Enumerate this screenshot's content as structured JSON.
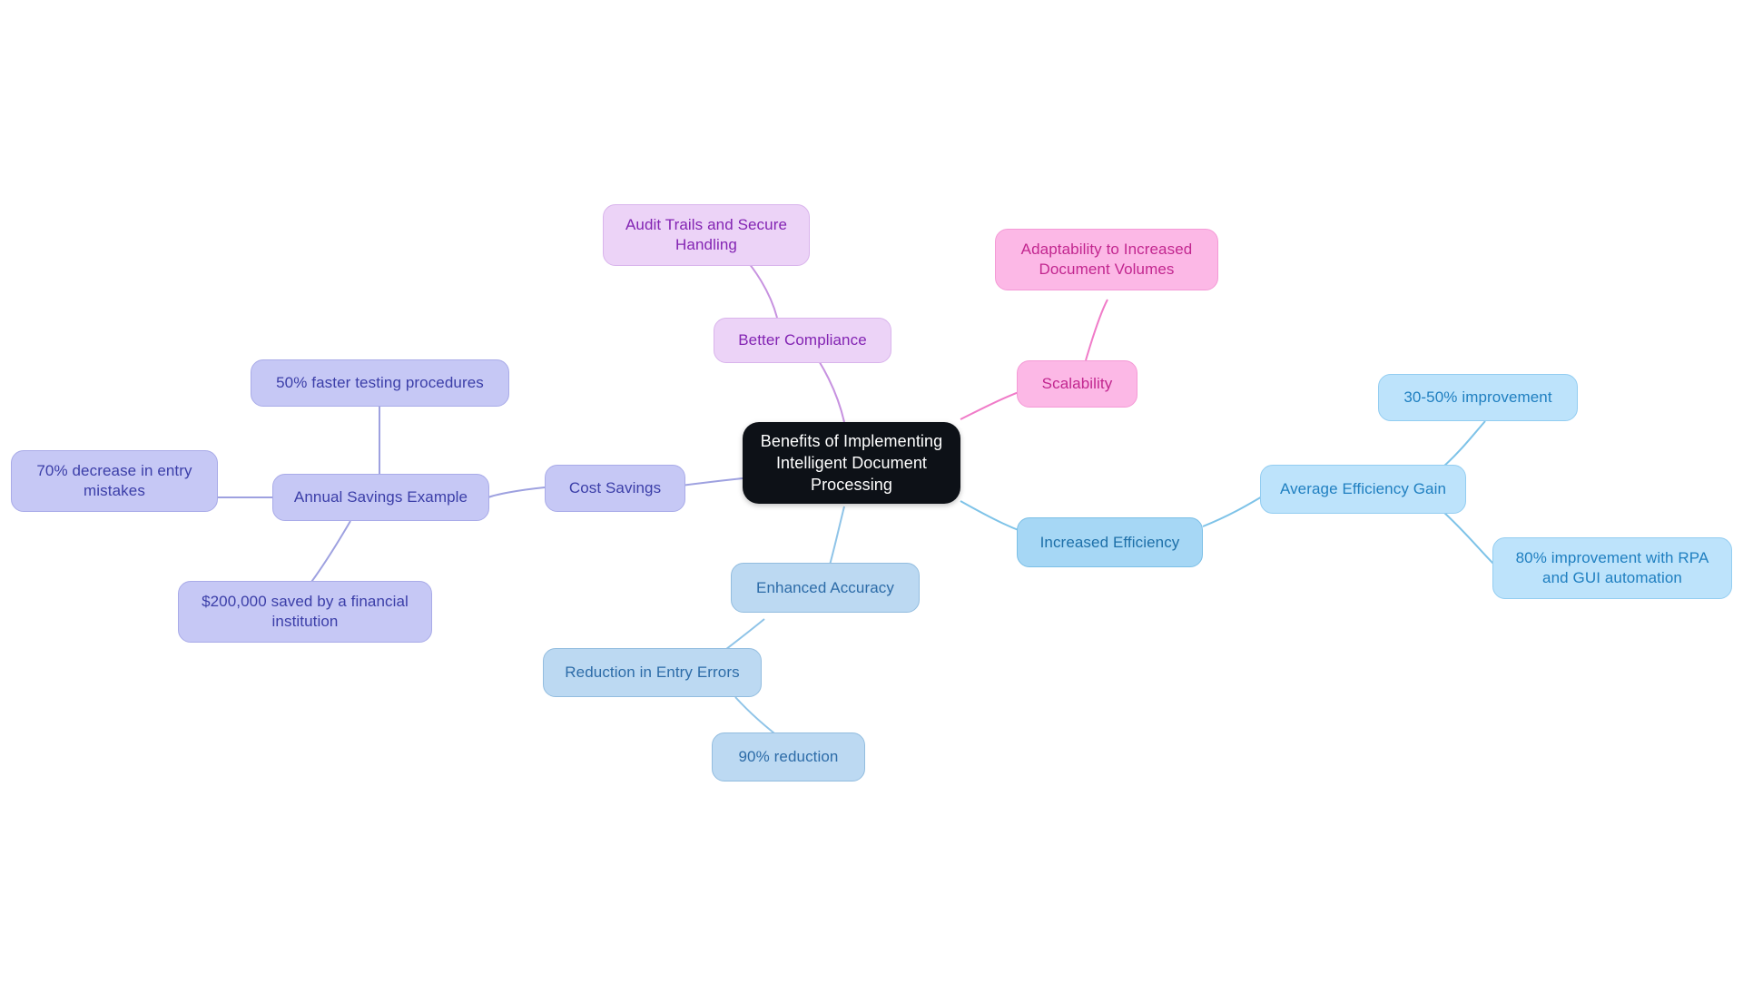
{
  "diagram": {
    "type": "mindmap",
    "title": "Benefits of Implementing Intelligent Document Processing",
    "background_color": "#ffffff",
    "root": {
      "id": "root",
      "label": "Benefits of Implementing\nIntelligent Document\nProcessing",
      "fill": "#0d1117",
      "text_color": "#ffffff"
    },
    "branches": [
      {
        "id": "better-compliance",
        "label": "Better Compliance",
        "fill": "#ecd3f7",
        "text_color": "#8324b3",
        "edge_color": "#c792e0",
        "children": [
          {
            "id": "audit-trails-and-secure-handling",
            "label": "Audit Trails and Secure\nHandling",
            "fill": "#ecd3f7",
            "text_color": "#8324b3",
            "edge_color": "#c792e0"
          }
        ]
      },
      {
        "id": "scalability",
        "label": "Scalability",
        "fill": "#fcb8e6",
        "text_color": "#c2268f",
        "edge_color": "#f07bc8",
        "children": [
          {
            "id": "adaptability-to-increased-document-volumes",
            "label": "Adaptability to Increased\nDocument Volumes",
            "fill": "#fcb8e6",
            "text_color": "#c2268f",
            "edge_color": "#f07bc8"
          }
        ]
      },
      {
        "id": "increased-efficiency",
        "label": "Increased Efficiency",
        "fill": "#a6d7f5",
        "text_color": "#1d6fa8",
        "edge_color": "#7ec3e8",
        "children": [
          {
            "id": "average-efficiency-gain",
            "label": "Average Efficiency Gain",
            "fill": "#bde3fb",
            "text_color": "#1f7fc0",
            "edge_color": "#7ec3e8",
            "children": [
              {
                "id": "30-50-improvement",
                "label": "30-50% improvement",
                "fill": "#bde3fb",
                "text_color": "#1f7fc0",
                "edge_color": "#7ec3e8"
              },
              {
                "id": "80-improvement-with-rpa-and-gui-automation",
                "label": "80% improvement with RPA\nand GUI automation",
                "fill": "#bde3fb",
                "text_color": "#1f7fc0",
                "edge_color": "#7ec3e8"
              }
            ]
          }
        ]
      },
      {
        "id": "enhanced-accuracy",
        "label": "Enhanced Accuracy",
        "fill": "#bcd9f2",
        "text_color": "#2d6ca8",
        "edge_color": "#8fc4e8",
        "children": [
          {
            "id": "reduction-in-entry-errors",
            "label": "Reduction in Entry Errors",
            "fill": "#bcd9f2",
            "text_color": "#2d6ca8",
            "edge_color": "#8fc4e8",
            "children": [
              {
                "id": "90-reduction",
                "label": "90% reduction",
                "fill": "#bcd9f2",
                "text_color": "#2d6ca8",
                "edge_color": "#8fc4e8"
              }
            ]
          }
        ]
      },
      {
        "id": "cost-savings",
        "label": "Cost Savings",
        "fill": "#c6c8f5",
        "text_color": "#3b3ea8",
        "edge_color": "#9ea1e0",
        "children": [
          {
            "id": "annual-savings-example",
            "label": "Annual Savings Example",
            "fill": "#c6c8f5",
            "text_color": "#3b3ea8",
            "edge_color": "#9ea1e0",
            "children": [
              {
                "id": "50-faster-testing-procedures",
                "label": "50% faster testing procedures",
                "fill": "#c6c8f5",
                "text_color": "#3b3ea8",
                "edge_color": "#9ea1e0"
              },
              {
                "id": "70-decrease-in-entry-mistakes",
                "label": "70% decrease in entry\nmistakes",
                "fill": "#c6c8f5",
                "text_color": "#3b3ea8",
                "edge_color": "#9ea1e0"
              },
              {
                "id": "200000-saved-by-a-financial-institution",
                "label": "$200,000 saved by a financial\ninstitution",
                "fill": "#c6c8f5",
                "text_color": "#3b3ea8",
                "edge_color": "#9ea1e0"
              }
            ]
          }
        ]
      }
    ]
  },
  "nodes": {
    "root": "Benefits of Implementing\nIntelligent Document\nProcessing",
    "audit_trails": "Audit Trails and Secure\nHandling",
    "better_compliance": "Better Compliance",
    "adaptability": "Adaptability to Increased\nDocument Volumes",
    "scalability": "Scalability",
    "improvement_30_50": "30-50% improvement",
    "average_efficiency_gain": "Average Efficiency Gain",
    "increased_efficiency": "Increased Efficiency",
    "improvement_80_rpa": "80% improvement with RPA\nand GUI automation",
    "enhanced_accuracy": "Enhanced Accuracy",
    "reduction_entry_errors": "Reduction in Entry Errors",
    "reduction_90": "90% reduction",
    "faster_testing_50": "50% faster testing procedures",
    "annual_savings_example": "Annual Savings Example",
    "cost_savings": "Cost Savings",
    "decrease_entry_mistakes_70": "70% decrease in entry\nmistakes",
    "saved_200000": "$200,000 saved by a financial\ninstitution"
  }
}
